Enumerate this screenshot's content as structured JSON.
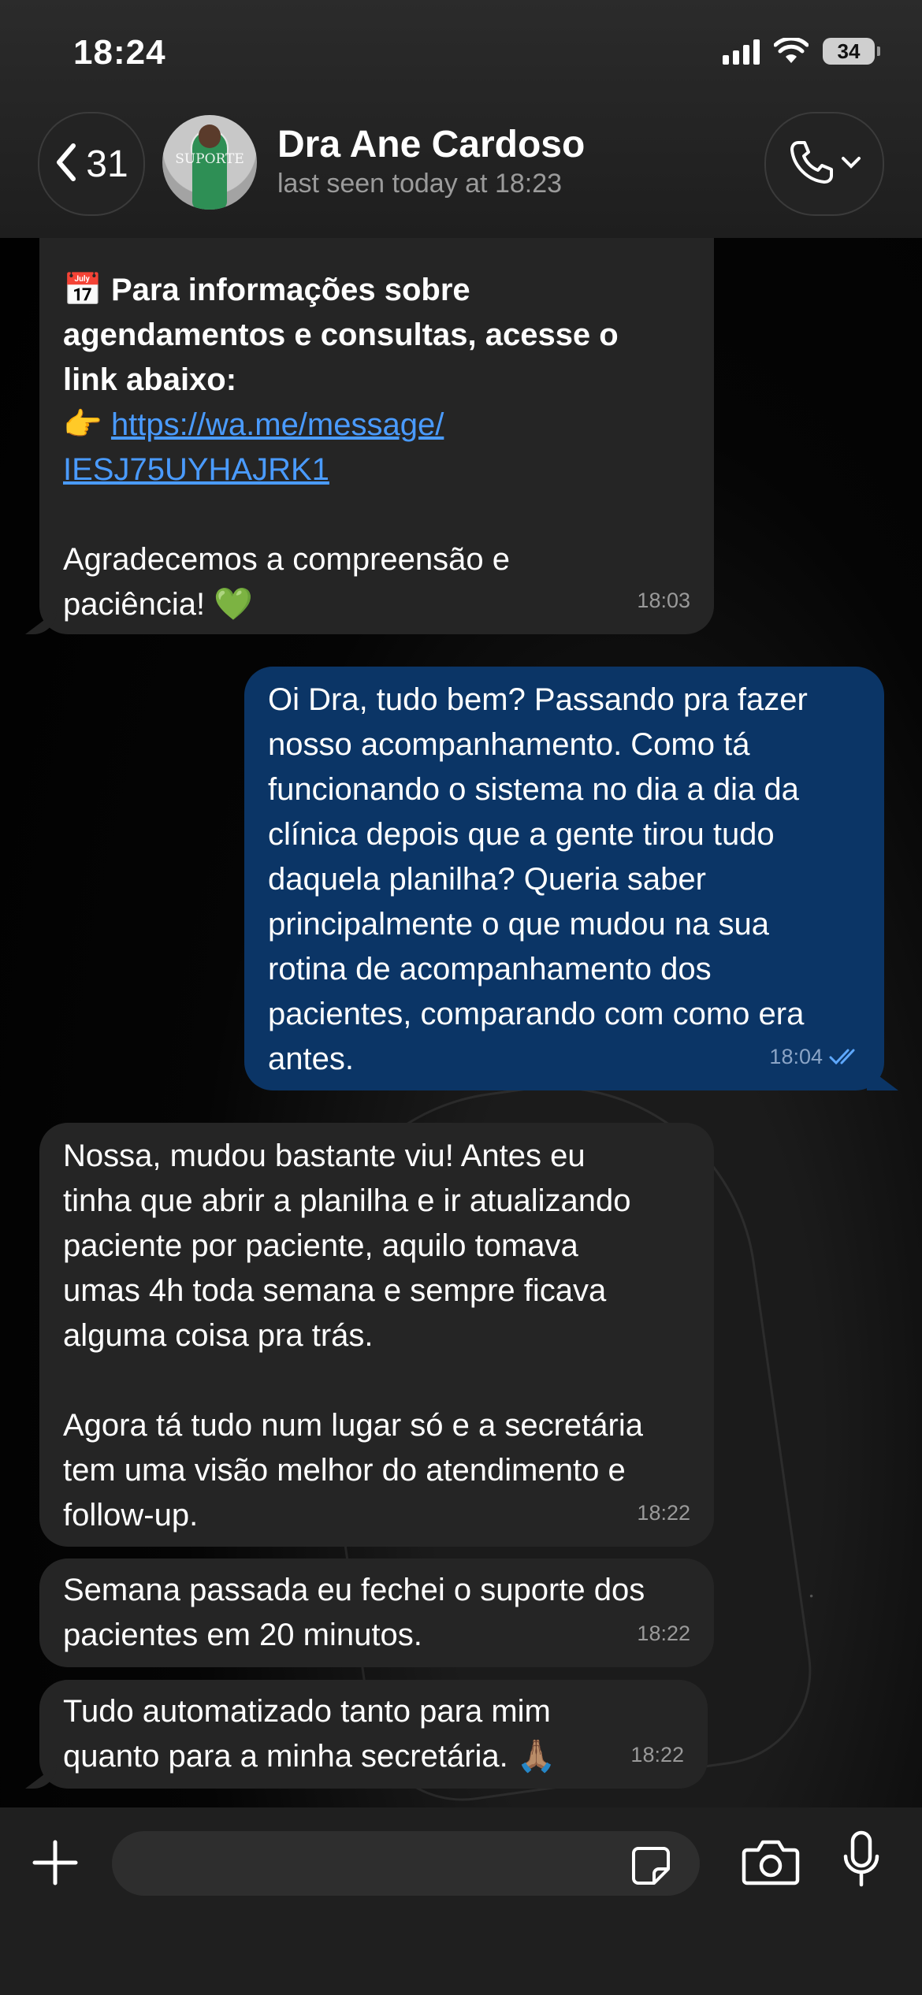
{
  "status_bar": {
    "time": "18:24",
    "battery": "34"
  },
  "header": {
    "back_count": "31",
    "avatar_text": "SUPORTE",
    "contact_name": "Dra Ane Cardoso",
    "last_seen": "last seen today at 18:23"
  },
  "messages": [
    {
      "direction": "incoming",
      "emoji_calendar": "📅",
      "bold_lines": [
        "Para informações sobre",
        "agendamentos e consultas, acesse o",
        "link abaixo:"
      ],
      "emoji_point": "👉",
      "link_lines": [
        "https://wa.me/message/",
        "IESJ75UYHAJRK1"
      ],
      "text_lines": [
        "Agradecemos a compreensão e",
        "paciência!"
      ],
      "emoji_heart": "💚",
      "time": "18:03"
    },
    {
      "direction": "outgoing",
      "text_lines": [
        "Oi Dra, tudo bem? Passando pra fazer",
        "nosso acompanhamento. Como tá",
        "funcionando o sistema no dia a dia da",
        "clínica depois que a gente tirou tudo",
        "daquela planilha? Queria saber",
        "principalmente o que mudou na sua",
        "rotina de acompanhamento dos",
        "pacientes, comparando com como era",
        "antes."
      ],
      "time": "18:04",
      "read": true
    },
    {
      "direction": "incoming",
      "text_lines": [
        "Nossa, mudou bastante viu! Antes eu",
        "tinha que abrir a planilha e ir atualizando",
        "paciente por paciente, aquilo tomava",
        "umas 4h toda semana e sempre ficava",
        "alguma coisa pra trás.",
        "",
        "Agora tá tudo num lugar só e a secretária",
        "tem uma visão melhor do atendimento e",
        "follow-up."
      ],
      "time": "18:22"
    },
    {
      "direction": "incoming",
      "text_lines": [
        "Semana passada eu fechei o suporte dos",
        "pacientes em 20 minutos."
      ],
      "time": "18:22"
    },
    {
      "direction": "incoming",
      "text_lines": [
        "Tudo automatizado tanto para mim",
        "quanto para a minha secretária."
      ],
      "emoji_pray": "🙏🏽",
      "time": "18:22"
    }
  ],
  "composer": {
    "placeholder": ""
  },
  "colors": {
    "incoming_bubble": "#252525",
    "outgoing_bubble": "#0b3566",
    "link": "#4a9bff"
  },
  "icons": [
    "chevron-left-icon",
    "phone-icon",
    "chevron-down-icon",
    "plus-icon",
    "sticker-icon",
    "camera-icon",
    "microphone-icon",
    "double-check-icon",
    "wifi-icon",
    "signal-icon",
    "battery-icon"
  ]
}
